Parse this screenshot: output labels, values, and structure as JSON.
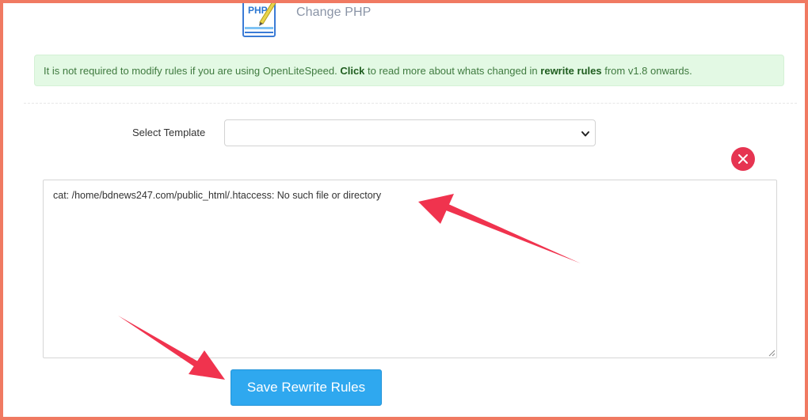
{
  "header": {
    "icon": "php-file-edit-icon",
    "icon_text": "PHP",
    "title": "Change PHP"
  },
  "alert": {
    "text_before": "It is not required to modify rules if you are using OpenLiteSpeed. ",
    "click_label": "Click",
    "text_middle": " to read more about whats changed in ",
    "rewrite_label": "rewrite rules",
    "text_after": " from v1.8 onwards."
  },
  "template": {
    "label": "Select Template",
    "selected": ""
  },
  "editor": {
    "content": "cat: /home/bdnews247.com/public_html/.htaccess: No such file or directory"
  },
  "actions": {
    "save_label": "Save Rewrite Rules"
  },
  "colors": {
    "frame": "#f07a62",
    "alert_bg": "#e3f9e4",
    "alert_text": "#3f7a3f",
    "close_button": "#e63451",
    "save_button": "#2fa8ef",
    "annotation_arrow": "#f0334e"
  }
}
